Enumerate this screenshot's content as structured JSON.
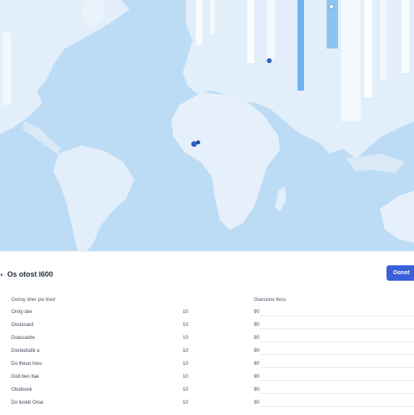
{
  "map": {
    "ocean_color": "#bcdcf6",
    "land_color": "#e2eefa",
    "marker_color": "#2f5fbf",
    "marker_icon": "map-pin-icon"
  },
  "panel": {
    "title": "Os otost I600",
    "title_icon": "globe-icon",
    "action_button": "Oonot"
  },
  "table": {
    "columns": [
      "Oonoy dner pw tned",
      "Ouesione tless"
    ],
    "rows": [
      {
        "name": "Ornty dex",
        "v1": "10",
        "v2": "90"
      },
      {
        "name": "Ooclesard",
        "v1": "10",
        "v2": "90"
      },
      {
        "name": "Doaccadre",
        "v1": "10",
        "v2": "90"
      },
      {
        "name": "Doctedsdik a",
        "v1": "10",
        "v2": "90"
      },
      {
        "name": "Do theuo Ioeu",
        "v1": "10",
        "v2": "90"
      },
      {
        "name": "Dod beo Itae",
        "v1": "10",
        "v2": "90"
      },
      {
        "name": "Otodoosk",
        "v1": "10",
        "v2": "90"
      },
      {
        "name": "Do Iuoeb Oroa",
        "v1": "10",
        "v2": "90"
      }
    ]
  },
  "accent_color": "#3a5fd8"
}
